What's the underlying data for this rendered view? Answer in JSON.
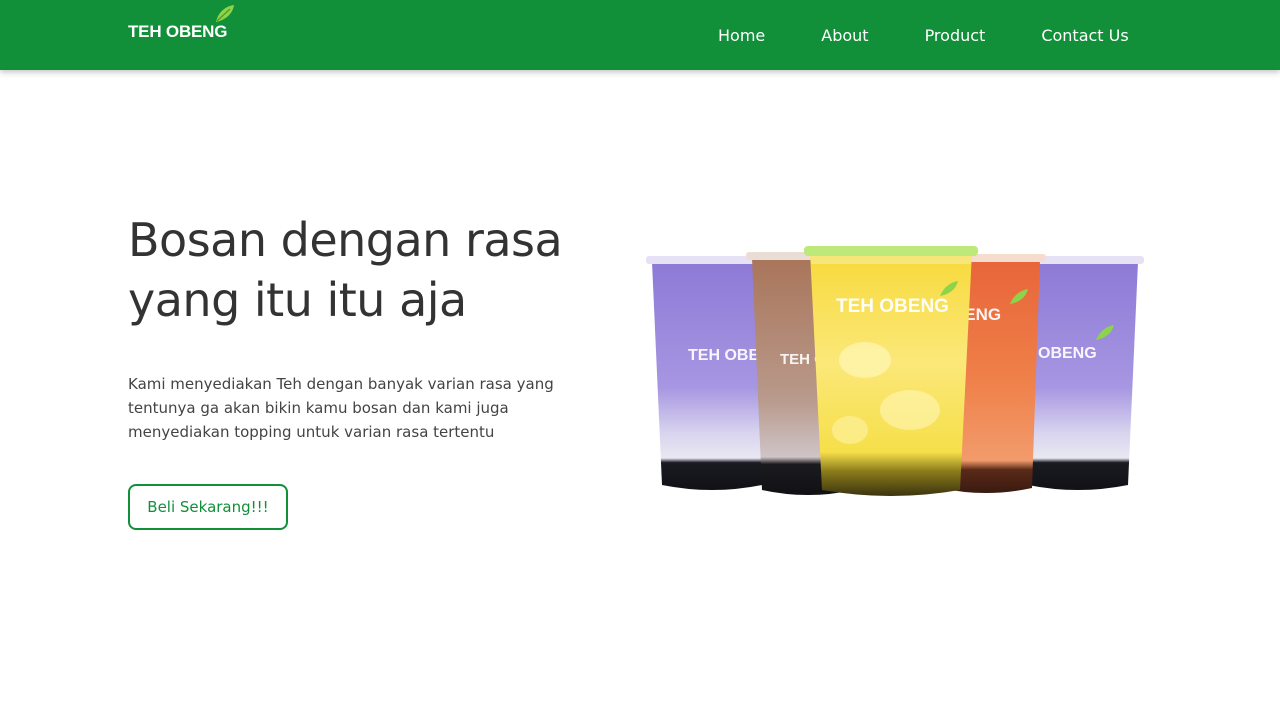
{
  "header": {
    "logo_text": "TEH OBENG",
    "nav": [
      {
        "label": "Home"
      },
      {
        "label": "About"
      },
      {
        "label": "Product"
      },
      {
        "label": "Contact Us"
      }
    ]
  },
  "hero": {
    "title_line1": "Bosan dengan rasa",
    "title_line2": "yang itu itu aja",
    "description": "Kami menyediakan Teh dengan banyak varian rasa yang tentunya ga akan bikin kamu bosan dan kami juga menyediakan topping untuk varian rasa tertentu",
    "cta_label": "Beli Sekarang!!!"
  },
  "product_image": {
    "cup_logo_text": "TEH OBENG"
  },
  "colors": {
    "brand_green": "#128f39",
    "title_text": "#333333",
    "body_text": "#444444"
  },
  "icons": {
    "logo_leaf": "leaf-icon"
  }
}
